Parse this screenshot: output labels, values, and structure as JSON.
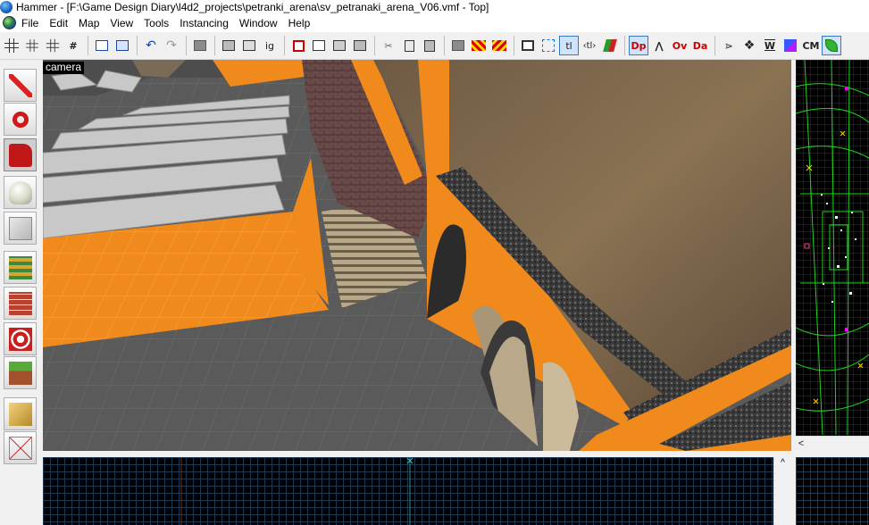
{
  "window": {
    "title": "Hammer - [F:\\Game Design Diary\\l4d2_projects\\petranki_arena\\sv_petranaki_arena_V06.vmf - Top]"
  },
  "menu": {
    "items": [
      "File",
      "Edit",
      "Map",
      "View",
      "Tools",
      "Instancing",
      "Window",
      "Help"
    ]
  },
  "toolbar": {
    "buttons": [
      {
        "icon": "grid-icon"
      },
      {
        "icon": "grid-smaller-icon"
      },
      {
        "icon": "grid-larger-icon"
      },
      {
        "icon": "grid-hash-icon"
      },
      {
        "icon": "cordon-icon"
      },
      {
        "icon": "cordon-box-icon"
      },
      {
        "icon": "undo-icon",
        "glyph": "↶"
      },
      {
        "icon": "redo-icon",
        "glyph": "↷"
      },
      {
        "icon": "carve-icon"
      },
      {
        "icon": "group-icon"
      },
      {
        "icon": "ungroup-icon"
      },
      {
        "icon": "ignore-groups-icon",
        "text": "ig"
      },
      {
        "icon": "hide-selected-icon"
      },
      {
        "icon": "show-selected-icon"
      },
      {
        "icon": "hide-unselected-icon"
      },
      {
        "icon": "show-all-icon"
      },
      {
        "icon": "cut-icon",
        "glyph": "✂"
      },
      {
        "icon": "copy-icon"
      },
      {
        "icon": "paste-icon"
      },
      {
        "icon": "tie-to-world-icon"
      },
      {
        "icon": "tie-to-entity-icon"
      },
      {
        "icon": "move-to-world-icon"
      },
      {
        "icon": "selection-box-icon"
      },
      {
        "icon": "selection-dashed-icon"
      },
      {
        "icon": "texture-lock-icon",
        "text": "tl"
      },
      {
        "icon": "texture-lock-scale-icon",
        "text": "‹tl›"
      },
      {
        "icon": "texture-apply-icon"
      },
      {
        "icon": "vertex-manipulation-icon",
        "text": "Dp"
      },
      {
        "icon": "clipping-tool-icon"
      },
      {
        "icon": "overlay-icon",
        "text": "Ov"
      },
      {
        "icon": "decal-icon",
        "text": "Da"
      },
      {
        "icon": "path-icon"
      },
      {
        "icon": "model-icon"
      },
      {
        "icon": "brushes-icon",
        "text": "W"
      },
      {
        "icon": "visgroup-icon"
      },
      {
        "icon": "cm-icon",
        "text": "CM"
      },
      {
        "icon": "leaf-icon"
      }
    ],
    "accent": "#3b78c4"
  },
  "tools": [
    {
      "icon": "pointer-icon",
      "label": "Selection Tool"
    },
    {
      "icon": "magnify-icon",
      "label": "Magnify"
    },
    {
      "icon": "camera-icon",
      "label": "Camera"
    },
    {
      "icon": "entity-icon",
      "label": "Entity Tool"
    },
    {
      "icon": "block-icon",
      "label": "Block Tool"
    },
    {
      "icon": "texture-application-icon",
      "label": "Toggle Texture Application"
    },
    {
      "icon": "apply-texture-icon",
      "label": "Apply Current Texture"
    },
    {
      "icon": "decals-icon",
      "label": "Apply Decals"
    },
    {
      "icon": "overlays-icon",
      "label": "Apply Overlays"
    },
    {
      "icon": "clipping-icon",
      "label": "Clipping Tool"
    },
    {
      "icon": "vertex-tool-icon",
      "label": "Vertex Tool"
    }
  ],
  "viewports": {
    "camera_label": "camera",
    "colors": {
      "nodraw_orange": "#f08a1c",
      "grid_2d": "#1c3b54",
      "brush_green": "#1ed51e",
      "floor_gray": "#5a5a5a"
    }
  }
}
